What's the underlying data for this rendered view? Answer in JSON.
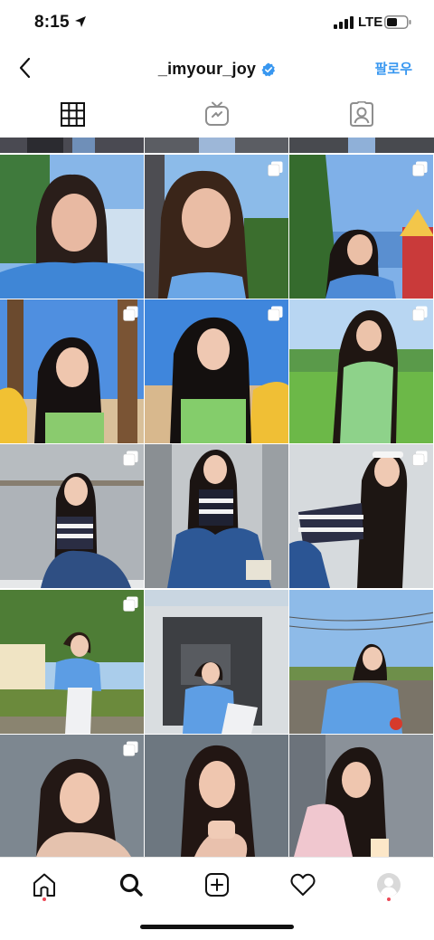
{
  "status_bar": {
    "time": "8:15",
    "network": "LTE",
    "icons": [
      "location-arrow-icon",
      "signal-bars-icon",
      "battery-icon"
    ]
  },
  "header": {
    "username": "_imyour_joy",
    "verified": true,
    "follow_label": "팔로우",
    "back_icon": "chevron-left-icon"
  },
  "tabs": [
    {
      "name": "grid",
      "icon": "grid-icon",
      "active": true
    },
    {
      "name": "igtv",
      "icon": "igtv-icon",
      "active": false
    },
    {
      "name": "tagged",
      "icon": "tagged-person-icon",
      "active": false
    }
  ],
  "grid": {
    "columns": 3,
    "multi_photo_posts": [
      "row1-col2",
      "row1-col3",
      "row2-col1",
      "row2-col2",
      "row2-col3",
      "row3-col1",
      "row3-col3",
      "row4-col1",
      "row5-col1"
    ]
  },
  "bottom_nav": [
    {
      "name": "home",
      "icon": "home-icon",
      "notification_dot": true
    },
    {
      "name": "search",
      "icon": "search-icon",
      "active": true
    },
    {
      "name": "new-post",
      "icon": "plus-square-icon"
    },
    {
      "name": "activity",
      "icon": "heart-icon"
    },
    {
      "name": "profile",
      "icon": "avatar-icon",
      "notification_dot": true
    }
  ],
  "colors": {
    "accent": "#3897f0",
    "verified": "#3897f0",
    "notification": "#ed4956",
    "text": "#111111"
  }
}
